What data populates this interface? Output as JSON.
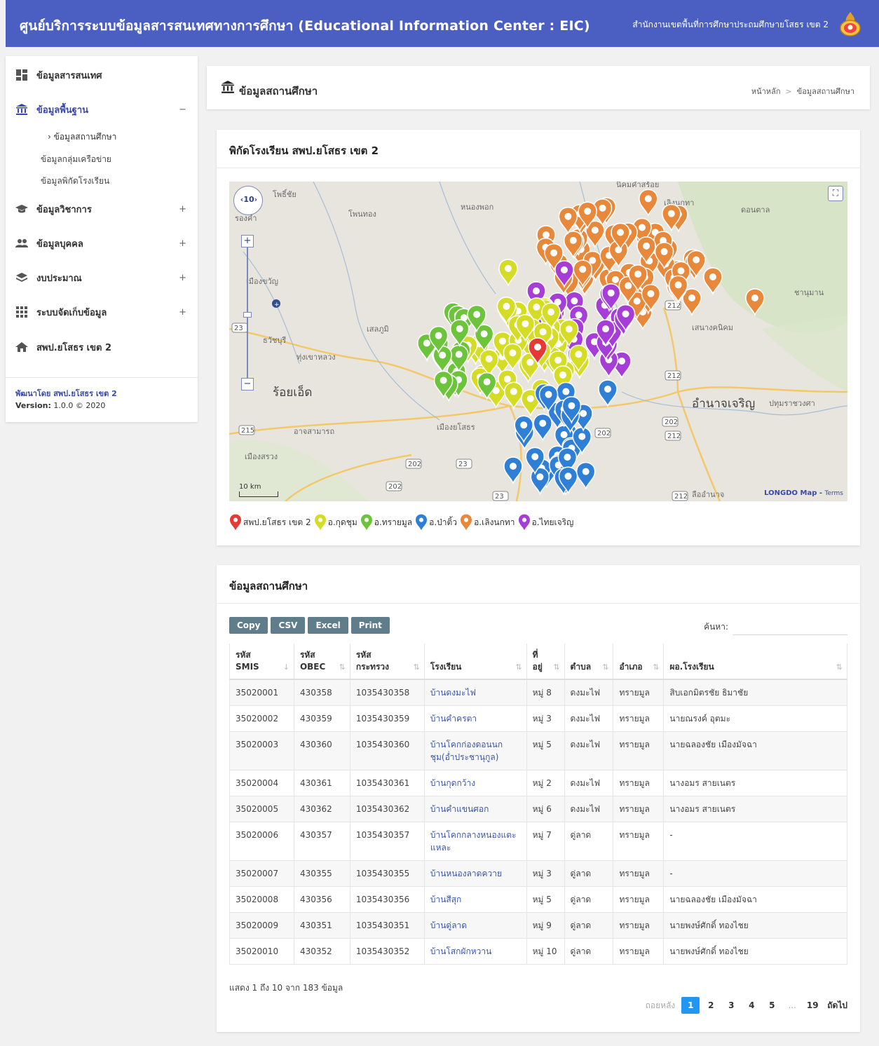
{
  "header": {
    "title": "ศูนย์บริการระบบข้อมูลสารสนเทศทางการศึกษา (Educational Information Center : EIC)",
    "office": "สำนักงานเขตพื้นที่การศึกษาประถมศึกษายโสธร เขต 2"
  },
  "sidebar": {
    "items": [
      {
        "label": "ข้อมูลสารสนเทศ",
        "toggle": ""
      },
      {
        "label": "ข้อมูลพื้นฐาน",
        "toggle": "−"
      },
      {
        "label": "ข้อมูลวิชาการ",
        "toggle": "+"
      },
      {
        "label": "ข้อมูลบุคคล",
        "toggle": "+"
      },
      {
        "label": "งบประมาณ",
        "toggle": "+"
      },
      {
        "label": "ระบบจัดเก็บข้อมูล",
        "toggle": "+"
      },
      {
        "label": "สพป.ยโสธร เขต 2",
        "toggle": ""
      }
    ],
    "sub_items": [
      "ข้อมูลสถานศึกษา",
      "ข้อมูลกลุ่มเครือข่าย",
      "ข้อมูลพิกัดโรงเรียน"
    ],
    "developer": "พัฒนาโดย สพป.ยโสธร เขต 2",
    "version_label": "Version:",
    "version_value": "1.0.0 © 2020"
  },
  "page": {
    "title": "ข้อมูลสถานศึกษา",
    "breadcrumb": [
      "หน้าหลัก",
      "ข้อมูลสถานศึกษา"
    ]
  },
  "map_card": {
    "title": "พิกัดโรงเรียน สพป.ยโสธร เขต 2",
    "zoom_level": "10",
    "scale": "10 km",
    "attribution": "LONGDO Map",
    "terms": "Terms",
    "places": [
      {
        "name": "โพธิ์ชัย"
      },
      {
        "name": "โพนทอง"
      },
      {
        "name": "หนองพอก"
      },
      {
        "name": "นิคมคำสร้อย"
      },
      {
        "name": "ดอนตาล"
      },
      {
        "name": "ชานุมาน"
      },
      {
        "name": "เสนางคนิคม"
      },
      {
        "name": "อำนาจเจริญ"
      },
      {
        "name": "ปทุมราชวงศา"
      },
      {
        "name": "ลืออำนาจ"
      },
      {
        "name": "เมืองยโสธร"
      },
      {
        "name": "อาจสามารถ"
      },
      {
        "name": "เมืองสรวง"
      },
      {
        "name": "ร้อยเอ็ด"
      },
      {
        "name": "ธวัชบุรี"
      },
      {
        "name": "ทุ่งเขาหลวง"
      },
      {
        "name": "เสลภูมิ"
      },
      {
        "name": "เมืองขวัญ"
      },
      {
        "name": "รองคำ"
      },
      {
        "name": "เลิงนกทา"
      }
    ],
    "roads": [
      "212",
      "212",
      "202",
      "212",
      "23",
      "202",
      "23",
      "202",
      "215",
      "23",
      "212",
      "202"
    ],
    "legend": [
      {
        "label": "สพป.ยโสธร เขต 2",
        "color": "#e53935"
      },
      {
        "label": "อ.กุดชุม",
        "color": "#d4dc26"
      },
      {
        "label": "อ.ทรายมูล",
        "color": "#6cc43a"
      },
      {
        "label": "อ.ป่าติ้ว",
        "color": "#2f7fd6"
      },
      {
        "label": "อ.เลิงนกทา",
        "color": "#e8883a"
      },
      {
        "label": "อ.ไทยเจริญ",
        "color": "#a63dd6"
      }
    ],
    "marker_counts": {
      "orange": 62,
      "purple": 28,
      "yellow": 48,
      "green": 20,
      "blue": 30,
      "red": 1
    }
  },
  "table_card": {
    "title": "ข้อมูลสถานศึกษา",
    "buttons": [
      "Copy",
      "CSV",
      "Excel",
      "Print"
    ],
    "search_label": "ค้นหา:",
    "columns": [
      {
        "line1": "รหัส",
        "line2": "SMIS",
        "sort": "↓"
      },
      {
        "line1": "รหัส",
        "line2": "OBEC",
        "sort": "⇅"
      },
      {
        "line1": "รหัส",
        "line2": "กระทรวง",
        "sort": "⇅"
      },
      {
        "line1": "",
        "line2": "โรงเรียน",
        "sort": "⇅"
      },
      {
        "line1": "ที่",
        "line2": "อยู่",
        "sort": "⇅"
      },
      {
        "line1": "",
        "line2": "ตำบล",
        "sort": "⇅"
      },
      {
        "line1": "",
        "line2": "อำเภอ",
        "sort": "⇅"
      },
      {
        "line1": "",
        "line2": "ผอ.โรงเรียน",
        "sort": "⇅"
      }
    ],
    "rows": [
      [
        "35020001",
        "430358",
        "1035430358",
        "บ้านดงมะไฟ",
        "หมู่ 8",
        "ดงมะไฟ",
        "ทรายมูล",
        "สิบเอกมิตรชัย ธิมาชัย"
      ],
      [
        "35020002",
        "430359",
        "1035430359",
        "บ้านคำครตา",
        "หมู่ 3",
        "ดงมะไฟ",
        "ทรายมูล",
        "นายณรงค์ อุตมะ"
      ],
      [
        "35020003",
        "430360",
        "1035430360",
        "บ้านโคกก่องดอนนกชุม(อ่ำประชานุกูล)",
        "หมู่ 5",
        "ดงมะไฟ",
        "ทรายมูล",
        "นายฉลองชัย เมืองมัจฉา"
      ],
      [
        "35020004",
        "430361",
        "1035430361",
        "บ้านกุดกว้าง",
        "หมู่ 2",
        "ดงมะไฟ",
        "ทรายมูล",
        "นางอมร สายเนตร"
      ],
      [
        "35020005",
        "430362",
        "1035430362",
        "บ้านคำแขนศอก",
        "หมู่ 6",
        "ดงมะไฟ",
        "ทรายมูล",
        "นางอมร สายเนตร"
      ],
      [
        "35020006",
        "430357",
        "1035430357",
        "บ้านโคกกลางหนองแตะแหละ",
        "หมู่ 7",
        "ดู่ลาด",
        "ทรายมูล",
        "-"
      ],
      [
        "35020007",
        "430355",
        "1035430355",
        "บ้านหนองลาดควาย",
        "หมู่ 3",
        "ดู่ลาด",
        "ทรายมูล",
        "-"
      ],
      [
        "35020008",
        "430356",
        "1035430356",
        "บ้านสีสุก",
        "หมู่ 5",
        "ดู่ลาด",
        "ทรายมูล",
        "นายฉลองชัย เมืองมัจฉา"
      ],
      [
        "35020009",
        "430351",
        "1035430351",
        "บ้านดู่ลาด",
        "หมู่ 9",
        "ดู่ลาด",
        "ทรายมูล",
        "นายพงษ์ศักดิ์ ทองไชย"
      ],
      [
        "35020010",
        "430352",
        "1035430352",
        "บ้านโสกผักหวาน",
        "หมู่ 10",
        "ดู่ลาด",
        "ทรายมูล",
        "นายพงษ์ศักดิ์ ทองไชย"
      ]
    ],
    "info": "แสดง 1 ถึง 10 จาก 183 ข้อมูล",
    "pagination": {
      "prev": "ถอยหลัง",
      "pages": [
        "1",
        "2",
        "3",
        "4",
        "5",
        "...",
        "19"
      ],
      "next": "ถัดไป",
      "current": "1"
    }
  }
}
